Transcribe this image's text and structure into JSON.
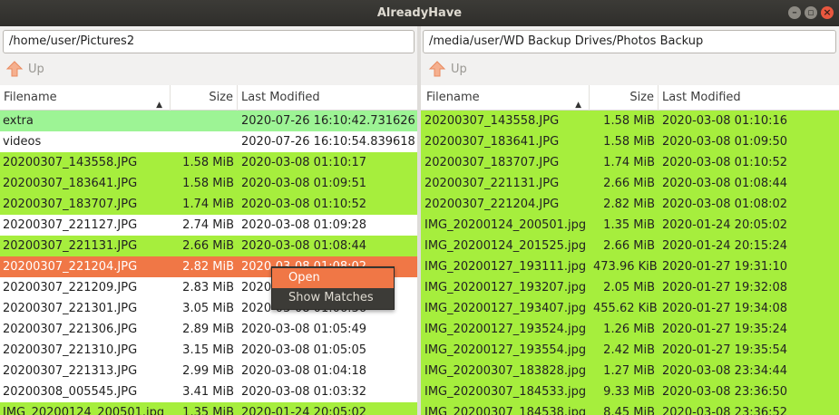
{
  "window": {
    "title": "AlreadyHave"
  },
  "left": {
    "path": "/home/user/Pictures2",
    "up_label": "Up",
    "headers": {
      "filename": "Filename",
      "size": "Size",
      "modified": "Last Modified"
    },
    "rows": [
      {
        "name": "extra",
        "size": "",
        "modified": "2020-07-26 16:10:42.731626",
        "status": "dir-match"
      },
      {
        "name": "videos",
        "size": "",
        "modified": "2020-07-26 16:10:54.839618",
        "status": "none"
      },
      {
        "name": "20200307_143558.JPG",
        "size": "1.58 MiB",
        "modified": "2020-03-08 01:10:17",
        "status": "match"
      },
      {
        "name": "20200307_183641.JPG",
        "size": "1.58 MiB",
        "modified": "2020-03-08 01:09:51",
        "status": "match"
      },
      {
        "name": "20200307_183707.JPG",
        "size": "1.74 MiB",
        "modified": "2020-03-08 01:10:52",
        "status": "match"
      },
      {
        "name": "20200307_221127.JPG",
        "size": "2.74 MiB",
        "modified": "2020-03-08 01:09:28",
        "status": "none"
      },
      {
        "name": "20200307_221131.JPG",
        "size": "2.66 MiB",
        "modified": "2020-03-08 01:08:44",
        "status": "match"
      },
      {
        "name": "20200307_221204.JPG",
        "size": "2.82 MiB",
        "modified": "2020-03-08 01:08:02",
        "status": "selected"
      },
      {
        "name": "20200307_221209.JPG",
        "size": "2.83 MiB",
        "modified": "2020-03-08 01:07:40",
        "status": "none"
      },
      {
        "name": "20200307_221301.JPG",
        "size": "3.05 MiB",
        "modified": "2020-03-08 01:06:36",
        "status": "none"
      },
      {
        "name": "20200307_221306.JPG",
        "size": "2.89 MiB",
        "modified": "2020-03-08 01:05:49",
        "status": "none"
      },
      {
        "name": "20200307_221310.JPG",
        "size": "3.15 MiB",
        "modified": "2020-03-08 01:05:05",
        "status": "none"
      },
      {
        "name": "20200307_221313.JPG",
        "size": "2.99 MiB",
        "modified": "2020-03-08 01:04:18",
        "status": "none"
      },
      {
        "name": "20200308_005545.JPG",
        "size": "3.41 MiB",
        "modified": "2020-03-08 01:03:32",
        "status": "none"
      },
      {
        "name": "IMG_20200124_200501.jpg",
        "size": "1.35 MiB",
        "modified": "2020-01-24 20:05:02",
        "status": "match"
      }
    ]
  },
  "right": {
    "path": "/media/user/WD Backup Drives/Photos Backup",
    "up_label": "Up",
    "headers": {
      "filename": "Filename",
      "size": "Size",
      "modified": "Last Modified"
    },
    "rows": [
      {
        "name": "20200307_143558.JPG",
        "size": "1.58 MiB",
        "modified": "2020-03-08 01:10:16"
      },
      {
        "name": "20200307_183641.JPG",
        "size": "1.58 MiB",
        "modified": "2020-03-08 01:09:50"
      },
      {
        "name": "20200307_183707.JPG",
        "size": "1.74 MiB",
        "modified": "2020-03-08 01:10:52"
      },
      {
        "name": "20200307_221131.JPG",
        "size": "2.66 MiB",
        "modified": "2020-03-08 01:08:44"
      },
      {
        "name": "20200307_221204.JPG",
        "size": "2.82 MiB",
        "modified": "2020-03-08 01:08:02"
      },
      {
        "name": "IMG_20200124_200501.jpg",
        "size": "1.35 MiB",
        "modified": "2020-01-24 20:05:02"
      },
      {
        "name": "IMG_20200124_201525.jpg",
        "size": "2.66 MiB",
        "modified": "2020-01-24 20:15:24"
      },
      {
        "name": "IMG_20200127_193111.jpg",
        "size": "473.96 KiB",
        "modified": "2020-01-27 19:31:10"
      },
      {
        "name": "IMG_20200127_193207.jpg",
        "size": "2.05 MiB",
        "modified": "2020-01-27 19:32:08"
      },
      {
        "name": "IMG_20200127_193407.jpg",
        "size": "455.62 KiB",
        "modified": "2020-01-27 19:34:08"
      },
      {
        "name": "IMG_20200127_193524.jpg",
        "size": "1.26 MiB",
        "modified": "2020-01-27 19:35:24"
      },
      {
        "name": "IMG_20200127_193554.jpg",
        "size": "2.42 MiB",
        "modified": "2020-01-27 19:35:54"
      },
      {
        "name": "IMG_20200307_183828.jpg",
        "size": "1.27 MiB",
        "modified": "2020-03-08 23:34:44"
      },
      {
        "name": "IMG_20200307_184533.jpg",
        "size": "9.33 MiB",
        "modified": "2020-03-08 23:36:50"
      },
      {
        "name": "IMG_20200307_184538.jpg",
        "size": "8.45 MiB",
        "modified": "2020-03-08 23:36:52"
      }
    ]
  },
  "context_menu": {
    "items": [
      "Open",
      "Show Matches"
    ],
    "highlighted": "Open"
  },
  "colors": {
    "match": "#a6ee3d",
    "dir_match": "#9df495",
    "selected": "#f07746",
    "menu_bg": "#3c3b37"
  }
}
